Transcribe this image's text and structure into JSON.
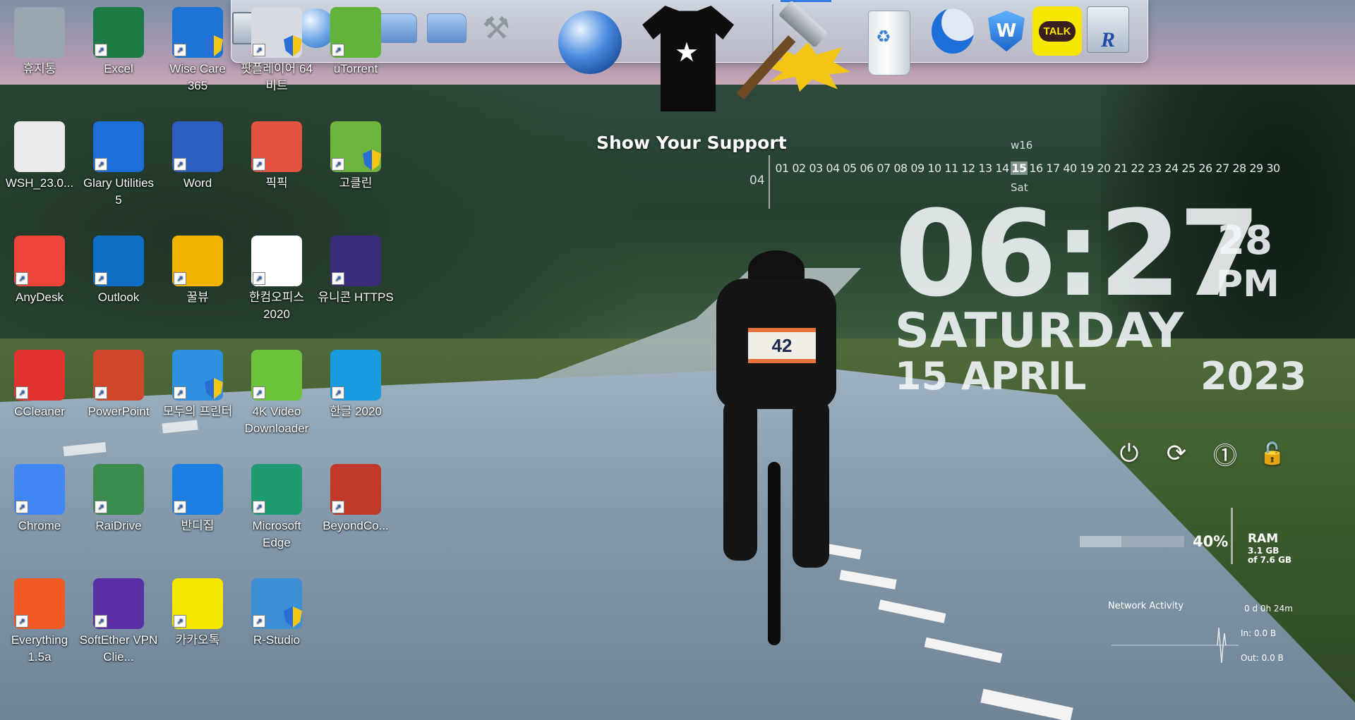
{
  "desktop": {
    "icons": [
      {
        "label": "휴지통",
        "icon": "recycle-bin-icon",
        "color": "#9aa7b3"
      },
      {
        "label": "Excel",
        "icon": "excel-icon",
        "color": "#1d7a45"
      },
      {
        "label": "Wise Care 365",
        "icon": "wise-care-icon",
        "color": "#1e74d6"
      },
      {
        "label": "팟플레이어 64 비트",
        "icon": "potplayer-icon",
        "color": "#d7dbe1"
      },
      {
        "label": "uTorrent",
        "icon": "utorrent-icon",
        "color": "#61b33a"
      },
      {
        "label": "WSH_23.0...",
        "icon": "document-icon",
        "color": "#e9e9e9"
      },
      {
        "label": "Glary Utilities 5",
        "icon": "glary-utilities-icon",
        "color": "#1c6fd8"
      },
      {
        "label": "Word",
        "icon": "word-icon",
        "color": "#2b5fc2"
      },
      {
        "label": "픽픽",
        "icon": "picpick-icon",
        "color": "#e4533f"
      },
      {
        "label": "고클린",
        "icon": "goclean-icon",
        "color": "#6fb33f"
      },
      {
        "label": "AnyDesk",
        "icon": "anydesk-icon",
        "color": "#ef443b"
      },
      {
        "label": "Outlook",
        "icon": "outlook-icon",
        "color": "#0f6fc6"
      },
      {
        "label": "꿀뷰",
        "icon": "honeyview-icon",
        "color": "#f0b400"
      },
      {
        "label": "한컴오피스 2020",
        "icon": "hancom-office-icon",
        "color": "#ffffff"
      },
      {
        "label": "유니콘 HTTPS",
        "icon": "unicorn-https-icon",
        "color": "#3a2a7a"
      },
      {
        "label": "CCleaner",
        "icon": "ccleaner-icon",
        "color": "#e0322f"
      },
      {
        "label": "PowerPoint",
        "icon": "powerpoint-icon",
        "color": "#d0462b"
      },
      {
        "label": "모두의 프린터",
        "icon": "printer-icon",
        "color": "#2f8fe0"
      },
      {
        "label": "4K Video Downloader",
        "icon": "video-downloader-icon",
        "color": "#6bc53a"
      },
      {
        "label": "한글 2020",
        "icon": "hangul-icon",
        "color": "#1a9be0"
      },
      {
        "label": "Chrome",
        "icon": "chrome-icon",
        "color": "#4285f4"
      },
      {
        "label": "RaiDrive",
        "icon": "raidrive-icon",
        "color": "#3b8a4f"
      },
      {
        "label": "반디집",
        "icon": "bandizip-icon",
        "color": "#1a7fe0"
      },
      {
        "label": "Microsoft Edge",
        "icon": "edge-icon",
        "color": "#1f9b74"
      },
      {
        "label": "BeyondCo...",
        "icon": "beyond-compare-icon",
        "color": "#c0392b"
      },
      {
        "label": "Everything 1.5a",
        "icon": "everything-search-icon",
        "color": "#f15a24"
      },
      {
        "label": "SoftEther VPN Clie...",
        "icon": "softether-vpn-icon",
        "color": "#5a2ea6"
      },
      {
        "label": "카카오톡",
        "icon": "kakaotalk-icon",
        "color": "#f7e600"
      },
      {
        "label": "R-Studio",
        "icon": "r-studio-icon",
        "color": "#3a8fd6"
      }
    ]
  },
  "dock": {
    "items": [
      {
        "icon": "monitor-icon"
      },
      {
        "icon": "media-player-icon"
      },
      {
        "icon": "network-folder-icon"
      },
      {
        "icon": "download-folder-icon"
      },
      {
        "icon": "documents-folder-icon"
      },
      {
        "icon": "drives-folder-icon"
      },
      {
        "icon": "tools-icon"
      },
      {
        "icon": "globe-icon"
      },
      {
        "icon": "tshirt-icon"
      },
      {
        "icon": "hammer-icon"
      },
      {
        "icon": "recycle-bin-icon"
      },
      {
        "icon": "glary-utilities-icon"
      },
      {
        "icon": "wise-care-icon"
      },
      {
        "icon": "kakaotalk-icon"
      },
      {
        "icon": "r-studio-icon"
      }
    ],
    "support_label": "Show Your Support",
    "talk_label": "TALK"
  },
  "calendar": {
    "week": "w16",
    "month": "04",
    "days": [
      "01",
      "02",
      "03",
      "04",
      "05",
      "06",
      "07",
      "08",
      "09",
      "10",
      "11",
      "12",
      "13",
      "14",
      "15",
      "16",
      "17",
      "40",
      "19",
      "20",
      "21",
      "22",
      "23",
      "24",
      "25",
      "26",
      "27",
      "28",
      "29",
      "30"
    ],
    "today": "15",
    "today_dow": "Sat"
  },
  "clock": {
    "time": "06:27",
    "seconds": "28",
    "ampm": "PM",
    "weekday": "SATURDAY",
    "date": "15 APRIL",
    "year": "2023"
  },
  "power": {
    "buttons": [
      {
        "icon": "power-icon",
        "glyph": "⏻"
      },
      {
        "icon": "restart-icon",
        "glyph": "⟳"
      },
      {
        "icon": "logoff-icon",
        "glyph": "⓵"
      },
      {
        "icon": "lock-icon",
        "glyph": "🔓"
      }
    ]
  },
  "ram": {
    "percent": 40,
    "percent_text": "40%",
    "label": "RAM",
    "used": "3.1 GB",
    "total": "of 7.6 GB"
  },
  "network": {
    "title": "Network Activity",
    "uptime": "0 d 0h 24m",
    "in": "In: 0.0 B",
    "out": "Out: 0.0 B"
  },
  "colors": {
    "accent": "#2f7de1",
    "bib_stripe": "#e5733a",
    "talk_yellow": "#f7e600"
  },
  "rider": {
    "bib_number": "42"
  }
}
